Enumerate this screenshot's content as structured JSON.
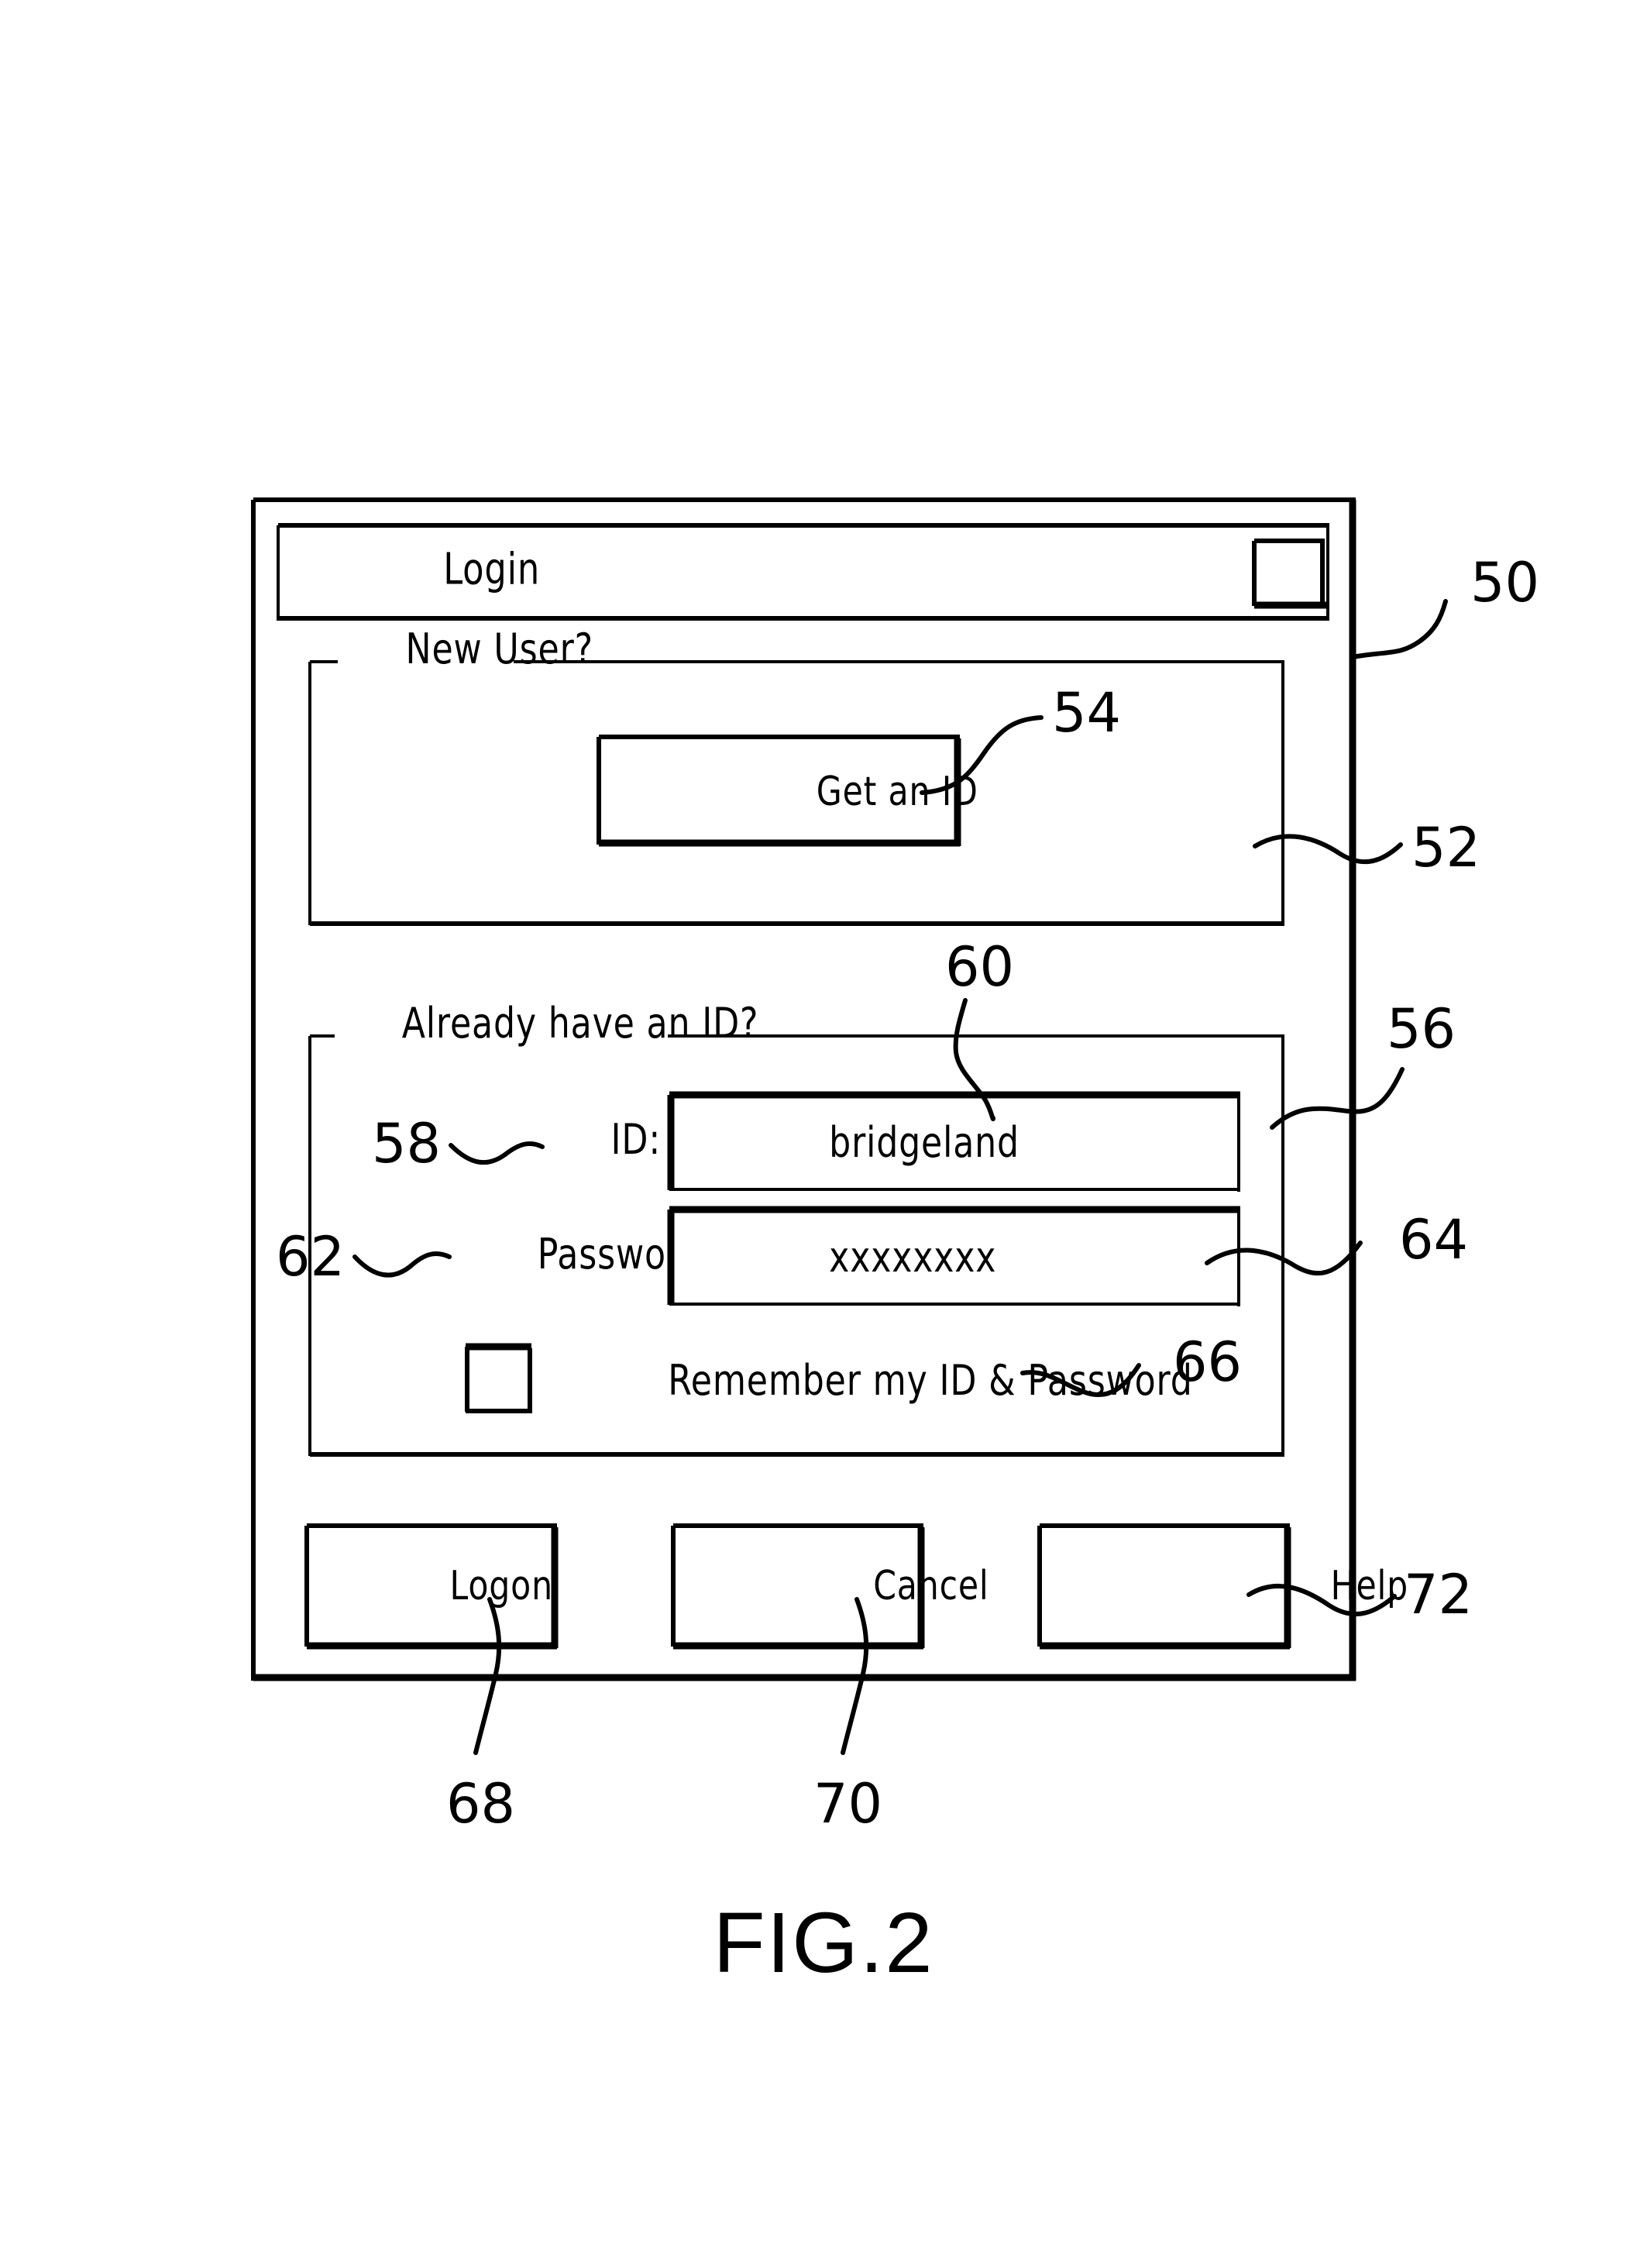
{
  "figure": {
    "caption": "FIG.2",
    "type": "patent-drawing",
    "description": "Login dialog window user interface"
  },
  "window": {
    "titlebar": {
      "title": "Login",
      "close_button": "close-box"
    },
    "ref": "50"
  },
  "groups": {
    "new_user": {
      "legend": "New User?",
      "ref": "52",
      "button": {
        "label": "Get an ID",
        "ref": "54"
      }
    },
    "existing_user": {
      "legend": "Already have an ID?",
      "ref": "56",
      "fields": [
        {
          "label": "ID:",
          "label_ref": "58",
          "value": "bridgeland",
          "value_ref": "60",
          "field_ref": "60"
        },
        {
          "label": "Password:",
          "label_ref": "62",
          "value": "xxxxxxxx",
          "field_ref": "64"
        }
      ],
      "checkbox": {
        "label": "Remember my ID & Password",
        "checked": false,
        "ref": "66"
      }
    }
  },
  "buttons": [
    {
      "label": "Logon",
      "ref": "68"
    },
    {
      "label": "Cancel",
      "ref": "70"
    },
    {
      "label": "Help",
      "ref": "72"
    }
  ],
  "colors": {
    "ink": "#000000",
    "paper": "#ffffff"
  }
}
